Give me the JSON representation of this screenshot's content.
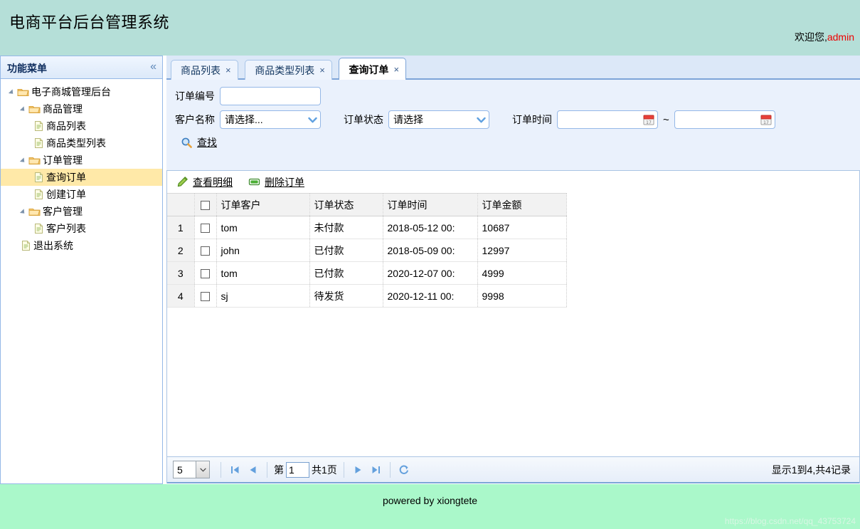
{
  "header": {
    "title": "电商平台后台管理系统",
    "welcome_text": "欢迎您,",
    "welcome_user": "admin"
  },
  "sidebar": {
    "title": "功能菜单",
    "collapse_icon": "double-chevron-left-icon",
    "tree": [
      {
        "label": "电子商城管理后台",
        "level": 1,
        "type": "folder",
        "expanded": true,
        "selected": false
      },
      {
        "label": "商品管理",
        "level": 2,
        "type": "folder",
        "expanded": true,
        "selected": false
      },
      {
        "label": "商品列表",
        "level": 3,
        "type": "file",
        "expanded": false,
        "selected": false
      },
      {
        "label": "商品类型列表",
        "level": 3,
        "type": "file",
        "expanded": false,
        "selected": false
      },
      {
        "label": "订单管理",
        "level": 2,
        "type": "folder",
        "expanded": true,
        "selected": false
      },
      {
        "label": "查询订单",
        "level": 3,
        "type": "file",
        "expanded": false,
        "selected": true
      },
      {
        "label": "创建订单",
        "level": 3,
        "type": "file",
        "expanded": false,
        "selected": false
      },
      {
        "label": "客户管理",
        "level": 2,
        "type": "folder",
        "expanded": true,
        "selected": false
      },
      {
        "label": "客户列表",
        "level": 3,
        "type": "file",
        "expanded": false,
        "selected": false
      },
      {
        "label": "退出系统",
        "level": 2,
        "type": "file",
        "expanded": false,
        "selected": false
      }
    ]
  },
  "tabs": [
    {
      "label": "商品列表",
      "active": false,
      "close": "×"
    },
    {
      "label": "商品类型列表",
      "active": false,
      "close": "×"
    },
    {
      "label": "查询订单",
      "active": true,
      "close": "×"
    }
  ],
  "search_form": {
    "order_no_label": "订单编号",
    "order_no_value": "",
    "order_no_placeholder": "",
    "customer_label": "客户名称",
    "customer_value": "请选择...",
    "status_label": "订单状态",
    "status_value": "请选择",
    "time_label": "订单时间",
    "time_from_value": "",
    "time_to_value": "",
    "range_separator": "~",
    "search_button": "查找",
    "search_icon": "magnifier-icon",
    "calendar_icon": "calendar-icon",
    "dropdown_icon": "chevron-down-icon"
  },
  "grid_toolbar": [
    {
      "label": "查看明细",
      "icon": "pencil-icon"
    },
    {
      "label": "删除订单",
      "icon": "green-bar-icon"
    }
  ],
  "grid": {
    "columns": [
      "",
      "",
      "订单客户",
      "订单状态",
      "订单时间",
      "订单金额"
    ],
    "header_checkbox": false,
    "rows": [
      {
        "index": "1",
        "checked": false,
        "customer": "tom",
        "status": "未付款",
        "time": "2018-05-12 00:",
        "amount": "10687"
      },
      {
        "index": "2",
        "checked": false,
        "customer": "john",
        "status": "已付款",
        "time": "2018-05-09 00:",
        "amount": "12997"
      },
      {
        "index": "3",
        "checked": false,
        "customer": "tom",
        "status": "已付款",
        "time": "2020-12-07 00:",
        "amount": "4999"
      },
      {
        "index": "4",
        "checked": false,
        "customer": "sj",
        "status": "待发货",
        "time": "2020-12-11 00:",
        "amount": "9998"
      }
    ]
  },
  "pager": {
    "page_size": "5",
    "first_icon": "first-page-icon",
    "prev_icon": "prev-page-icon",
    "page_prefix": "第",
    "page_number": "1",
    "page_total": "共1页",
    "next_icon": "next-page-icon",
    "last_icon": "last-page-icon",
    "refresh_icon": "refresh-icon",
    "info": "显示1到4,共4记录"
  },
  "footer": {
    "text": "powered by xiongtete",
    "watermark": "https://blog.csdn.net/qq_43753724"
  }
}
